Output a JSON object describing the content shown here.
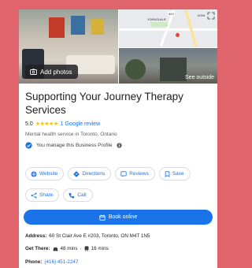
{
  "photos": {
    "add_photos_label": "Add photos",
    "see_outside_label": "See outside",
    "map_labels": [
      "YORKDALE",
      "401",
      "DON"
    ]
  },
  "business": {
    "name": "Supporting Your Journey Therapy Services",
    "rating": "5.0",
    "stars": "★★★★★",
    "review_count": "1 Google review",
    "category": "Mental health service in Toronto, Ontario",
    "manage_text": "You manage this Business Profile"
  },
  "actions": {
    "website": "Website",
    "directions": "Directions",
    "reviews": "Reviews",
    "save": "Save",
    "share": "Share",
    "call": "Call",
    "book_online": "Book online"
  },
  "info": {
    "address_label": "Address:",
    "address_value": "60 St Clair Ave E #203, Toronto, ON M4T 1N5",
    "get_there_label": "Get There:",
    "drive_time": "48 mins",
    "transit_time": "16 mins",
    "phone_label": "Phone:",
    "phone_value": "(416) 451-2247"
  },
  "colors": {
    "background": "#e0646b",
    "accent": "#1a73e8",
    "star": "#fbbc04"
  }
}
